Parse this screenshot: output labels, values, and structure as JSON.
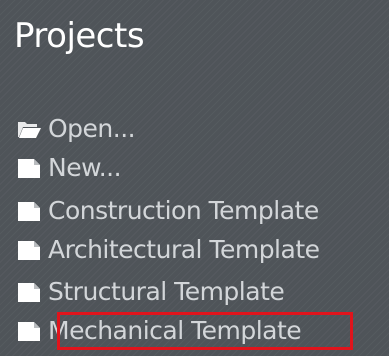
{
  "panel": {
    "title": "Projects"
  },
  "menu": {
    "items": [
      {
        "label": "Open...",
        "icon": "folder-open-icon"
      },
      {
        "label": "New...",
        "icon": "document-icon"
      },
      {
        "label": "Construction Template",
        "icon": "document-icon"
      },
      {
        "label": "Architectural Template",
        "icon": "document-icon"
      },
      {
        "label": "Structural Template",
        "icon": "document-icon"
      },
      {
        "label": "Mechanical Template",
        "icon": "document-icon",
        "highlighted": true
      }
    ]
  },
  "colors": {
    "background": "#4f5459",
    "title": "#ffffff",
    "item_text": "#d3d6d9",
    "highlight_border": "#e0141c"
  }
}
